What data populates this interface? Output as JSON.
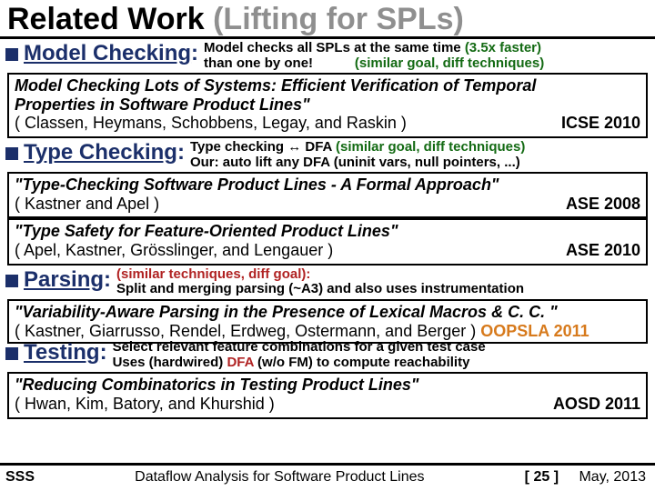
{
  "title_main": "Related Work ",
  "title_sub": "(Lifting for SPLs)",
  "sec_model_checking": {
    "head": "Model Checking",
    "l1a": "Model checks all SPLs at the same time ",
    "l1b": "(3.5x faster)",
    "l2a": "than one by one!           ",
    "l2b": "(similar goal, diff techniques)"
  },
  "box_mc": {
    "q1": "Model Checking Lots of Systems: Efficient Verification of Temporal",
    "q2": "Properties in Software Product Lines\"",
    "authors": "( Classen, Heymans, Schobbens, Legay, and Raskin )",
    "venue": "ICSE 2010"
  },
  "sec_type_checking": {
    "head": "Type Checking",
    "l1a": "Type checking ↔ DFA ",
    "l1b": "(similar goal, diff techniques)",
    "l2": "Our: auto lift any DFA (uninit vars, null pointers, ...)"
  },
  "box_tc1": {
    "q": "\"Type-Checking Software Product Lines - A Formal Approach\"",
    "authors": "( Kastner and Apel )",
    "venue": "ASE 2008"
  },
  "box_tc2": {
    "q": "\"Type Safety for Feature-Oriented Product Lines\"",
    "authors": "( Apel, Kastner, Grösslinger, and Lengauer )",
    "venue": "ASE 2010"
  },
  "sec_parsing": {
    "head": "Parsing",
    "l1": "(similar techniques, diff goal):",
    "l2": "Split and merging parsing (~A3) and also uses instrumentation"
  },
  "box_parse": {
    "q": "\"Variability-Aware Parsing in the Presence of Lexical Macros & C. C. \"",
    "authors": "( Kastner, Giarrusso, Rendel, Erdweg, Ostermann, and Berger ) ",
    "venue": "OOPSLA 2011"
  },
  "sec_testing": {
    "head": "Testing",
    "l1": "Select relevant feature combinations for a given test case",
    "l2a": "Uses (hardwired) ",
    "l2b": "DFA",
    "l2c": " (w/o FM) to compute reachability"
  },
  "box_test": {
    "q": "\"Reducing Combinatorics in Testing Product Lines\"",
    "authors": "( Hwan, Kim, Batory, and Khurshid )",
    "venue": "AOSD 2011"
  },
  "footer": {
    "left": "SSS",
    "mid": "Dataflow Analysis for Software Product Lines",
    "page": "[ 25 ]",
    "date": "May, 2013"
  }
}
